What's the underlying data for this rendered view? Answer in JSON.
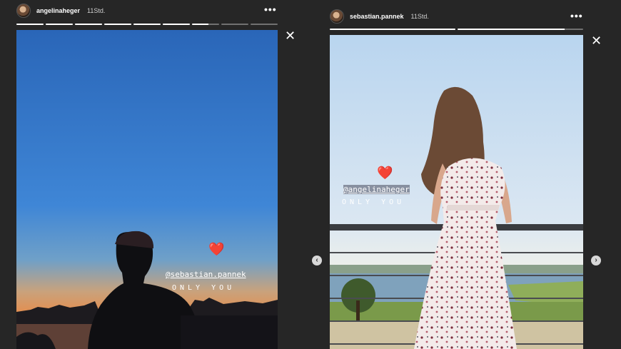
{
  "left_story": {
    "username": "angelinaheger",
    "time": "11Std.",
    "more_icon": "more-horizontal-icon",
    "progress": [
      1,
      1,
      1,
      1,
      1,
      1,
      0.6,
      0,
      0
    ],
    "mention": "@sebastian.pannek",
    "caption": "ONLY YOU",
    "sticker": "heart-emoji"
  },
  "right_story": {
    "username": "sebastian.pannek",
    "time": "11Std.",
    "more_icon": "more-horizontal-icon",
    "progress": [
      1,
      0.85
    ],
    "mention": "@angelinaheger",
    "caption": "ONLY YOU",
    "sticker": "heart-emoji"
  },
  "controls": {
    "close_glyph": "✕",
    "prev_glyph": "‹",
    "next_glyph": "›"
  },
  "colors": {
    "background": "#262626",
    "sky_top": "#2f6fbd",
    "sunset": "#f08a3a",
    "text": "#ffffff"
  }
}
